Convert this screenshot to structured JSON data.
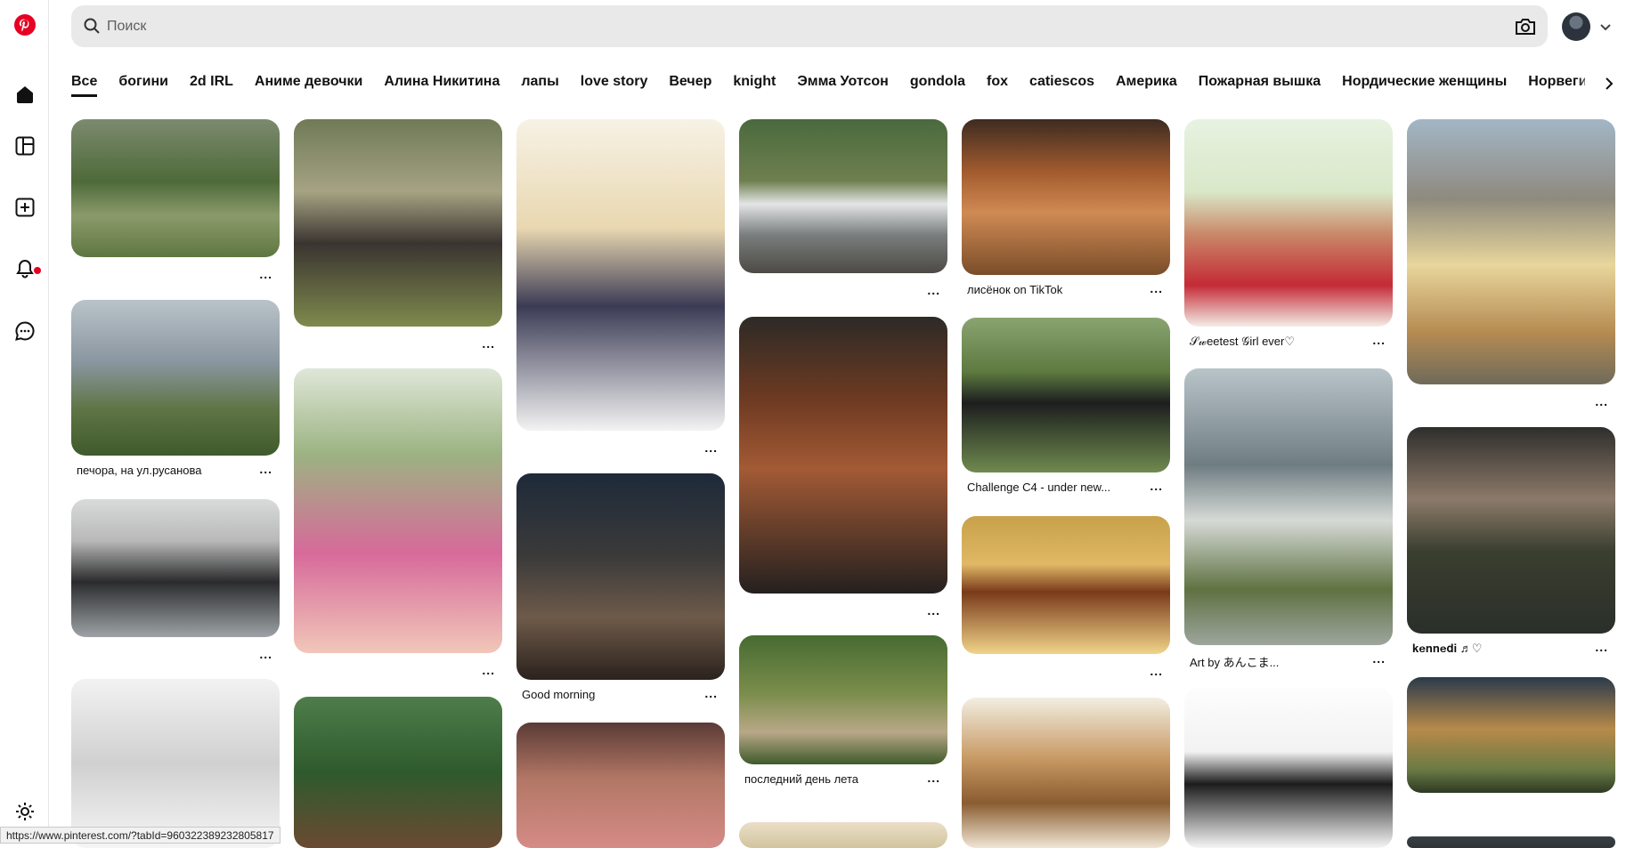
{
  "sidebar": {
    "items": [
      {
        "name": "pinterest-logo-icon"
      },
      {
        "name": "home-icon"
      },
      {
        "name": "explore-icon"
      },
      {
        "name": "create-icon"
      },
      {
        "name": "notifications-icon"
      },
      {
        "name": "messages-icon"
      },
      {
        "name": "settings-icon"
      }
    ],
    "brand_color": "#e60023"
  },
  "search": {
    "placeholder": "Поиск",
    "value": ""
  },
  "tabs": [
    {
      "label": "Все",
      "active": true
    },
    {
      "label": "богини"
    },
    {
      "label": "2d IRL"
    },
    {
      "label": "Аниме девочки"
    },
    {
      "label": "Алина Никитина"
    },
    {
      "label": "лапы"
    },
    {
      "label": "love story"
    },
    {
      "label": "Вечер"
    },
    {
      "label": "knight"
    },
    {
      "label": "Эмма Уотсон"
    },
    {
      "label": "gondola"
    },
    {
      "label": "fox"
    },
    {
      "label": "catiescos"
    },
    {
      "label": "Америка"
    },
    {
      "label": "Пожарная вышка"
    },
    {
      "label": "Нордические женщины"
    },
    {
      "label": "Норвегия"
    }
  ],
  "pins": [
    {
      "title": "",
      "more": "..."
    },
    {
      "title": "печора, на ул.русанова",
      "more": "..."
    },
    {
      "title": "",
      "more": "..."
    },
    {
      "title": "",
      "more": ""
    },
    {
      "title": "",
      "more": "..."
    },
    {
      "title": "",
      "more": "..."
    },
    {
      "title": "",
      "more": ""
    },
    {
      "title": "",
      "more": "..."
    },
    {
      "title": "Good morning",
      "more": "..."
    },
    {
      "title": "",
      "more": ""
    },
    {
      "title": "",
      "more": "..."
    },
    {
      "title": "",
      "more": "..."
    },
    {
      "title": "последний день лета",
      "more": "..."
    },
    {
      "title": "",
      "more": ""
    },
    {
      "title": "лисёнок on TikTok",
      "more": "..."
    },
    {
      "title": "Challenge C4 - under new...",
      "more": "..."
    },
    {
      "title": "",
      "more": "..."
    },
    {
      "title": "",
      "more": ""
    },
    {
      "title": "𝒮𝓌eetest 𝒢irl ever♡",
      "more": "..."
    },
    {
      "title": "Art by あんこま...",
      "more": "..."
    },
    {
      "title": "",
      "more": ""
    },
    {
      "title": "",
      "more": "..."
    },
    {
      "title": "𝐤𝐞𝐧𝐧𝐞𝐝𝐢 ♬♡",
      "more": "..."
    },
    {
      "title": "",
      "more": ""
    },
    {
      "title": "",
      "more": ""
    }
  ],
  "status_url": "https://www.pinterest.com/?tabId=960322389232805817"
}
